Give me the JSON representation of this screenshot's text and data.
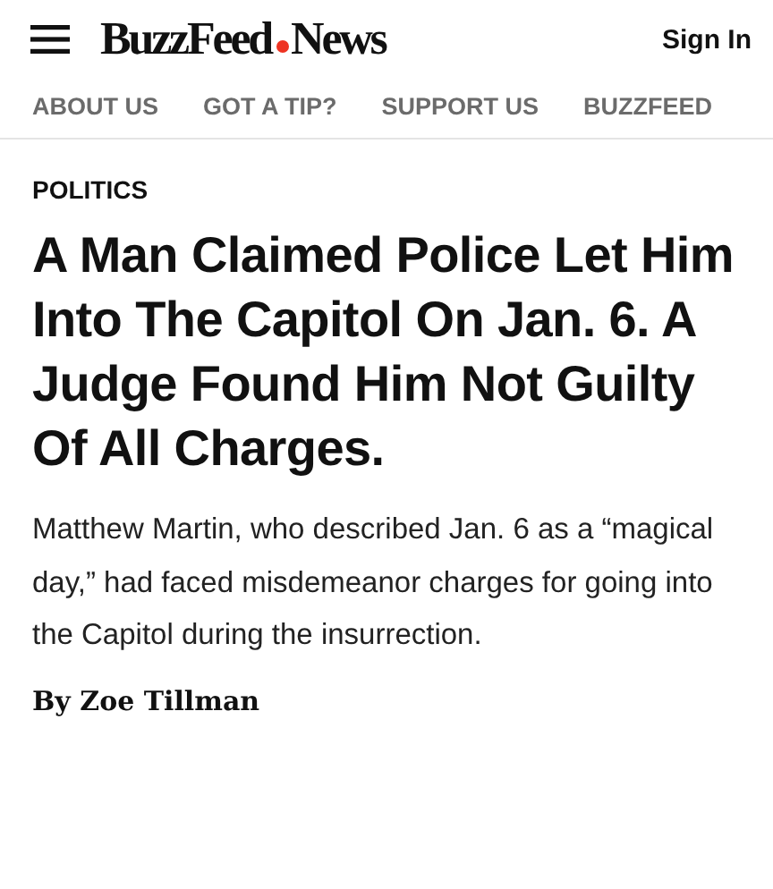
{
  "header": {
    "logo_primary": "BuzzFeed",
    "logo_secondary": "News",
    "sign_in": "Sign In"
  },
  "nav": [
    "ABOUT US",
    "GOT A TIP?",
    "SUPPORT US",
    "BUZZFEED"
  ],
  "article": {
    "section": "POLITICS",
    "headline": "A Man Claimed Police Let Him Into The Capitol On Jan. 6. A Judge Found Him Not Guilty Of All Charges.",
    "dek": "Matthew Martin, who described Jan. 6 as a “magical day,” had faced misdemeanor charges for going into the Capitol during the insurrection.",
    "byline": "By Zoe Tillman"
  }
}
